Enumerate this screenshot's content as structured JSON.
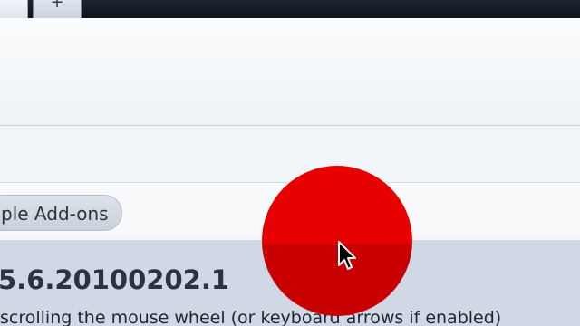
{
  "tabs": {
    "new_tab_glyph": "+"
  },
  "addons": {
    "enable_button_label": "ple Add-ons",
    "selected_addon": {
      "version": "5.6.20100202.1",
      "description": "scrolling the mouse wheel (or keyboard arrows if enabled)"
    }
  },
  "overlay": {
    "click_marker_color": "#e60000",
    "cursor_icon": "arrow-cursor-icon"
  }
}
